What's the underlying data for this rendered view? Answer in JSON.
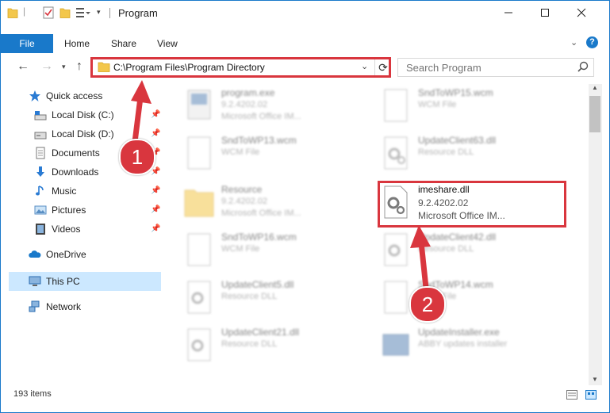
{
  "window": {
    "title": "Program"
  },
  "ribbon": {
    "tabs": [
      "File",
      "Home",
      "Share",
      "View"
    ]
  },
  "address": {
    "path": "C:\\Program Files\\Program Directory"
  },
  "search": {
    "placeholder": "Search Program"
  },
  "nav": {
    "items": [
      {
        "label": "Quick access"
      },
      {
        "label": "Local Disk (C:)"
      },
      {
        "label": "Local Disk (D:)"
      },
      {
        "label": "Documents"
      },
      {
        "label": "Downloads"
      },
      {
        "label": "Music"
      },
      {
        "label": "Pictures"
      },
      {
        "label": "Videos"
      },
      {
        "label": "OneDrive"
      },
      {
        "label": "This PC"
      },
      {
        "label": "Network"
      }
    ]
  },
  "files": [
    {
      "name": "program.exe",
      "line2": "9.2.4202.02",
      "line3": "Microsoft Office IM..."
    },
    {
      "name": "SndToWP15.wcm",
      "line2": "WCM File",
      "line3": ""
    },
    {
      "name": "SndToWP13.wcm",
      "line2": "WCM File",
      "line3": ""
    },
    {
      "name": "UpdateClient63.dll",
      "line2": "Resource DLL",
      "line3": ""
    },
    {
      "name": "Resource",
      "line2": "9.2.4202.02",
      "line3": "Microsoft Office IM..."
    },
    {
      "name": "imeshare.dll",
      "line2": "9.2.4202.02",
      "line3": "Microsoft Office IM..."
    },
    {
      "name": "SndToWP16.wcm",
      "line2": "WCM File",
      "line3": ""
    },
    {
      "name": "UpdateClient42.dll",
      "line2": "Resource DLL",
      "line3": ""
    },
    {
      "name": "UpdateClient5.dll",
      "line2": "Resource DLL",
      "line3": ""
    },
    {
      "name": "SndToWP14.wcm",
      "line2": "WCM File",
      "line3": ""
    },
    {
      "name": "UpdateClient21.dll",
      "line2": "Resource DLL",
      "line3": ""
    },
    {
      "name": "UpdateInstaller.exe",
      "line2": "ABBY updates installer",
      "line3": ""
    }
  ],
  "status": {
    "count": "193 items"
  },
  "annotations": {
    "step1": "1",
    "step2": "2"
  },
  "colors": {
    "accent": "#1979ca",
    "highlight": "#d9363e",
    "selected": "#cce8ff"
  }
}
